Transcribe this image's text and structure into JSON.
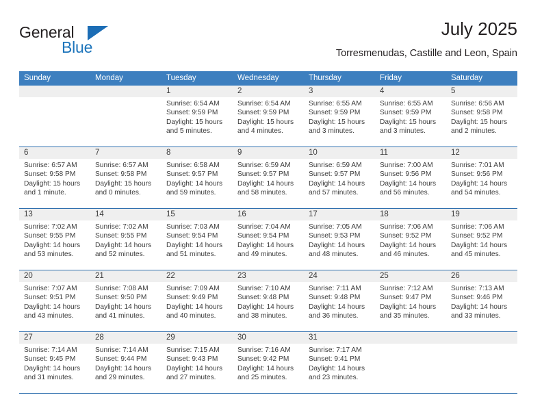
{
  "brand": {
    "name_part1": "General",
    "name_part2": "Blue"
  },
  "header": {
    "month_title": "July 2025",
    "location": "Torresmenudas, Castille and Leon, Spain"
  },
  "colors": {
    "header_blue": "#3d7fbf",
    "row_divider_blue": "#2f6fae",
    "daybar_gray": "#efefef",
    "brand_blue": "#1c74bb",
    "text": "#3c3c3c"
  },
  "weekdays": [
    "Sunday",
    "Monday",
    "Tuesday",
    "Wednesday",
    "Thursday",
    "Friday",
    "Saturday"
  ],
  "weeks": [
    [
      {
        "day": "",
        "sunrise": "",
        "sunset": "",
        "daylight_l1": "",
        "daylight_l2": "",
        "empty": true
      },
      {
        "day": "",
        "sunrise": "",
        "sunset": "",
        "daylight_l1": "",
        "daylight_l2": "",
        "empty": true
      },
      {
        "day": "1",
        "sunrise": "Sunrise: 6:54 AM",
        "sunset": "Sunset: 9:59 PM",
        "daylight_l1": "Daylight: 15 hours",
        "daylight_l2": "and 5 minutes."
      },
      {
        "day": "2",
        "sunrise": "Sunrise: 6:54 AM",
        "sunset": "Sunset: 9:59 PM",
        "daylight_l1": "Daylight: 15 hours",
        "daylight_l2": "and 4 minutes."
      },
      {
        "day": "3",
        "sunrise": "Sunrise: 6:55 AM",
        "sunset": "Sunset: 9:59 PM",
        "daylight_l1": "Daylight: 15 hours",
        "daylight_l2": "and 3 minutes."
      },
      {
        "day": "4",
        "sunrise": "Sunrise: 6:55 AM",
        "sunset": "Sunset: 9:59 PM",
        "daylight_l1": "Daylight: 15 hours",
        "daylight_l2": "and 3 minutes."
      },
      {
        "day": "5",
        "sunrise": "Sunrise: 6:56 AM",
        "sunset": "Sunset: 9:58 PM",
        "daylight_l1": "Daylight: 15 hours",
        "daylight_l2": "and 2 minutes."
      }
    ],
    [
      {
        "day": "6",
        "sunrise": "Sunrise: 6:57 AM",
        "sunset": "Sunset: 9:58 PM",
        "daylight_l1": "Daylight: 15 hours",
        "daylight_l2": "and 1 minute."
      },
      {
        "day": "7",
        "sunrise": "Sunrise: 6:57 AM",
        "sunset": "Sunset: 9:58 PM",
        "daylight_l1": "Daylight: 15 hours",
        "daylight_l2": "and 0 minutes."
      },
      {
        "day": "8",
        "sunrise": "Sunrise: 6:58 AM",
        "sunset": "Sunset: 9:57 PM",
        "daylight_l1": "Daylight: 14 hours",
        "daylight_l2": "and 59 minutes."
      },
      {
        "day": "9",
        "sunrise": "Sunrise: 6:59 AM",
        "sunset": "Sunset: 9:57 PM",
        "daylight_l1": "Daylight: 14 hours",
        "daylight_l2": "and 58 minutes."
      },
      {
        "day": "10",
        "sunrise": "Sunrise: 6:59 AM",
        "sunset": "Sunset: 9:57 PM",
        "daylight_l1": "Daylight: 14 hours",
        "daylight_l2": "and 57 minutes."
      },
      {
        "day": "11",
        "sunrise": "Sunrise: 7:00 AM",
        "sunset": "Sunset: 9:56 PM",
        "daylight_l1": "Daylight: 14 hours",
        "daylight_l2": "and 56 minutes."
      },
      {
        "day": "12",
        "sunrise": "Sunrise: 7:01 AM",
        "sunset": "Sunset: 9:56 PM",
        "daylight_l1": "Daylight: 14 hours",
        "daylight_l2": "and 54 minutes."
      }
    ],
    [
      {
        "day": "13",
        "sunrise": "Sunrise: 7:02 AM",
        "sunset": "Sunset: 9:55 PM",
        "daylight_l1": "Daylight: 14 hours",
        "daylight_l2": "and 53 minutes."
      },
      {
        "day": "14",
        "sunrise": "Sunrise: 7:02 AM",
        "sunset": "Sunset: 9:55 PM",
        "daylight_l1": "Daylight: 14 hours",
        "daylight_l2": "and 52 minutes."
      },
      {
        "day": "15",
        "sunrise": "Sunrise: 7:03 AM",
        "sunset": "Sunset: 9:54 PM",
        "daylight_l1": "Daylight: 14 hours",
        "daylight_l2": "and 51 minutes."
      },
      {
        "day": "16",
        "sunrise": "Sunrise: 7:04 AM",
        "sunset": "Sunset: 9:54 PM",
        "daylight_l1": "Daylight: 14 hours",
        "daylight_l2": "and 49 minutes."
      },
      {
        "day": "17",
        "sunrise": "Sunrise: 7:05 AM",
        "sunset": "Sunset: 9:53 PM",
        "daylight_l1": "Daylight: 14 hours",
        "daylight_l2": "and 48 minutes."
      },
      {
        "day": "18",
        "sunrise": "Sunrise: 7:06 AM",
        "sunset": "Sunset: 9:52 PM",
        "daylight_l1": "Daylight: 14 hours",
        "daylight_l2": "and 46 minutes."
      },
      {
        "day": "19",
        "sunrise": "Sunrise: 7:06 AM",
        "sunset": "Sunset: 9:52 PM",
        "daylight_l1": "Daylight: 14 hours",
        "daylight_l2": "and 45 minutes."
      }
    ],
    [
      {
        "day": "20",
        "sunrise": "Sunrise: 7:07 AM",
        "sunset": "Sunset: 9:51 PM",
        "daylight_l1": "Daylight: 14 hours",
        "daylight_l2": "and 43 minutes."
      },
      {
        "day": "21",
        "sunrise": "Sunrise: 7:08 AM",
        "sunset": "Sunset: 9:50 PM",
        "daylight_l1": "Daylight: 14 hours",
        "daylight_l2": "and 41 minutes."
      },
      {
        "day": "22",
        "sunrise": "Sunrise: 7:09 AM",
        "sunset": "Sunset: 9:49 PM",
        "daylight_l1": "Daylight: 14 hours",
        "daylight_l2": "and 40 minutes."
      },
      {
        "day": "23",
        "sunrise": "Sunrise: 7:10 AM",
        "sunset": "Sunset: 9:48 PM",
        "daylight_l1": "Daylight: 14 hours",
        "daylight_l2": "and 38 minutes."
      },
      {
        "day": "24",
        "sunrise": "Sunrise: 7:11 AM",
        "sunset": "Sunset: 9:48 PM",
        "daylight_l1": "Daylight: 14 hours",
        "daylight_l2": "and 36 minutes."
      },
      {
        "day": "25",
        "sunrise": "Sunrise: 7:12 AM",
        "sunset": "Sunset: 9:47 PM",
        "daylight_l1": "Daylight: 14 hours",
        "daylight_l2": "and 35 minutes."
      },
      {
        "day": "26",
        "sunrise": "Sunrise: 7:13 AM",
        "sunset": "Sunset: 9:46 PM",
        "daylight_l1": "Daylight: 14 hours",
        "daylight_l2": "and 33 minutes."
      }
    ],
    [
      {
        "day": "27",
        "sunrise": "Sunrise: 7:14 AM",
        "sunset": "Sunset: 9:45 PM",
        "daylight_l1": "Daylight: 14 hours",
        "daylight_l2": "and 31 minutes."
      },
      {
        "day": "28",
        "sunrise": "Sunrise: 7:14 AM",
        "sunset": "Sunset: 9:44 PM",
        "daylight_l1": "Daylight: 14 hours",
        "daylight_l2": "and 29 minutes."
      },
      {
        "day": "29",
        "sunrise": "Sunrise: 7:15 AM",
        "sunset": "Sunset: 9:43 PM",
        "daylight_l1": "Daylight: 14 hours",
        "daylight_l2": "and 27 minutes."
      },
      {
        "day": "30",
        "sunrise": "Sunrise: 7:16 AM",
        "sunset": "Sunset: 9:42 PM",
        "daylight_l1": "Daylight: 14 hours",
        "daylight_l2": "and 25 minutes."
      },
      {
        "day": "31",
        "sunrise": "Sunrise: 7:17 AM",
        "sunset": "Sunset: 9:41 PM",
        "daylight_l1": "Daylight: 14 hours",
        "daylight_l2": "and 23 minutes."
      },
      {
        "day": "",
        "sunrise": "",
        "sunset": "",
        "daylight_l1": "",
        "daylight_l2": "",
        "empty": true
      },
      {
        "day": "",
        "sunrise": "",
        "sunset": "",
        "daylight_l1": "",
        "daylight_l2": "",
        "empty": true
      }
    ]
  ]
}
